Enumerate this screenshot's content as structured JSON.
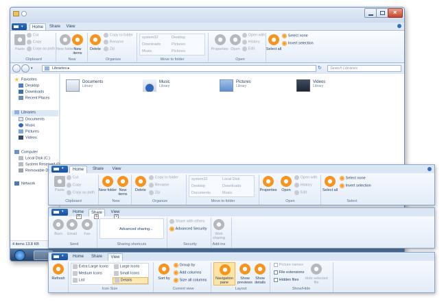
{
  "main_window": {
    "tabs": [
      "Home",
      "Share",
      "View"
    ],
    "ribbon": {
      "clipboard": {
        "paste": "Paste",
        "cut": "Cut",
        "copy": "Copy",
        "copy_path": "Copy as path",
        "label": "Clipboard"
      },
      "new": {
        "new_folder": "New folder",
        "new_items": "New items",
        "label": "New"
      },
      "organize": {
        "delete": "Delete",
        "copy_to": "Copy to folder",
        "rename": "Rename",
        "zip": "Zip",
        "label": "Organize"
      },
      "move": {
        "items": [
          "system32",
          "Desktop",
          "Downloads",
          "Pictures",
          "Music",
          "Pictures"
        ],
        "label": "Move to folder"
      },
      "open": {
        "properties": "Properties",
        "open": "Open",
        "open_with": "Open with",
        "history": "History",
        "edit": "Edit",
        "label": "Open"
      },
      "select": {
        "select_all": "Select all",
        "select_none": "Select none",
        "invert": "Invert selection"
      }
    },
    "address": "Libraries",
    "search_placeholder": "Search Libraries",
    "nav": {
      "favorites": "Favorites",
      "fav_items": [
        "Desktop",
        "Downloads",
        "Recent Places"
      ],
      "libraries": "Libraries",
      "lib_items": [
        "Documents",
        "Music",
        "Pictures",
        "Videos"
      ],
      "computer": "Computer",
      "comp_items": [
        "Local Disk (C:)",
        "System Reserved (D:",
        "Removable Disk (E:"
      ],
      "network": "Network"
    },
    "libraries": [
      {
        "name": "Documents",
        "sub": "Library"
      },
      {
        "name": "Music",
        "sub": "Library"
      },
      {
        "name": "Pictures",
        "sub": "Library"
      },
      {
        "name": "Videos",
        "sub": "Library"
      }
    ],
    "status": "4 items  13.8 KB"
  },
  "home_ribbon": {
    "tabs": [
      "Home",
      "Share",
      "View"
    ],
    "paste": "Paste",
    "cut": "Cut",
    "copy": "Copy",
    "copy_path": "Copy as path",
    "clipboard": "Clipboard",
    "new_folder": "New folder",
    "new_items": "New items",
    "new": "New",
    "delete": "Delete",
    "copy_to": "Copy to folder",
    "rename": "Rename",
    "zip": "Zip",
    "organize": "Organize",
    "move_items": [
      "system32",
      "Local Disk",
      "Desktop",
      "Downloads",
      "Documents",
      "Music"
    ],
    "move_label": "Move to folder",
    "properties": "Properties",
    "open": "Open",
    "open_with": "Open with",
    "history": "History",
    "edit": "Edit",
    "open_label": "Open",
    "select_all": "Select all",
    "select_none": "Select none",
    "invert": "Invert selection",
    "select_label": "Select"
  },
  "share_ribbon": {
    "tabs": [
      "Home",
      "Share",
      "View"
    ],
    "key_tips": [
      "H",
      "S",
      "V"
    ],
    "burn": "Burn",
    "email": "Email",
    "fax": "Fax",
    "send": "Send",
    "advanced_sharing": "Advanced sharing...",
    "sharing_shortcuts": "Sharing shortcuts",
    "share_with_others": "Share with others",
    "advanced_security": "Advanced Security",
    "security": "Security",
    "web_sharing": "Web sharing",
    "addins": "Add-ins"
  },
  "view_ribbon": {
    "tabs": [
      "Home",
      "Share",
      "View"
    ],
    "refresh": "Refresh",
    "icon_sizes": [
      "Extra Large Icons",
      "Large Icons",
      "Medium Icons",
      "Small Icons",
      "List",
      "Details"
    ],
    "icon_size_label": "Icon Size",
    "sort_by": "Sort by",
    "group_by": "Group by",
    "add_columns": "Add columns",
    "size_all_columns": "Size all columns",
    "current_view": "Current view",
    "navigation_pane": "Navigation pane",
    "show_previews": "Show previews",
    "show_details": "Show details",
    "layout": "Layout",
    "picture_names": "Picture names",
    "file_extensions": "File extensions",
    "hidden_files": "Hidden files",
    "hide_selected": "Hide selected file",
    "show_hide": "Show/Hide"
  },
  "colors": {
    "accent": "#f7941d",
    "ribbon_border": "#8aa6c9",
    "app_menu": "#1b4f9b"
  }
}
